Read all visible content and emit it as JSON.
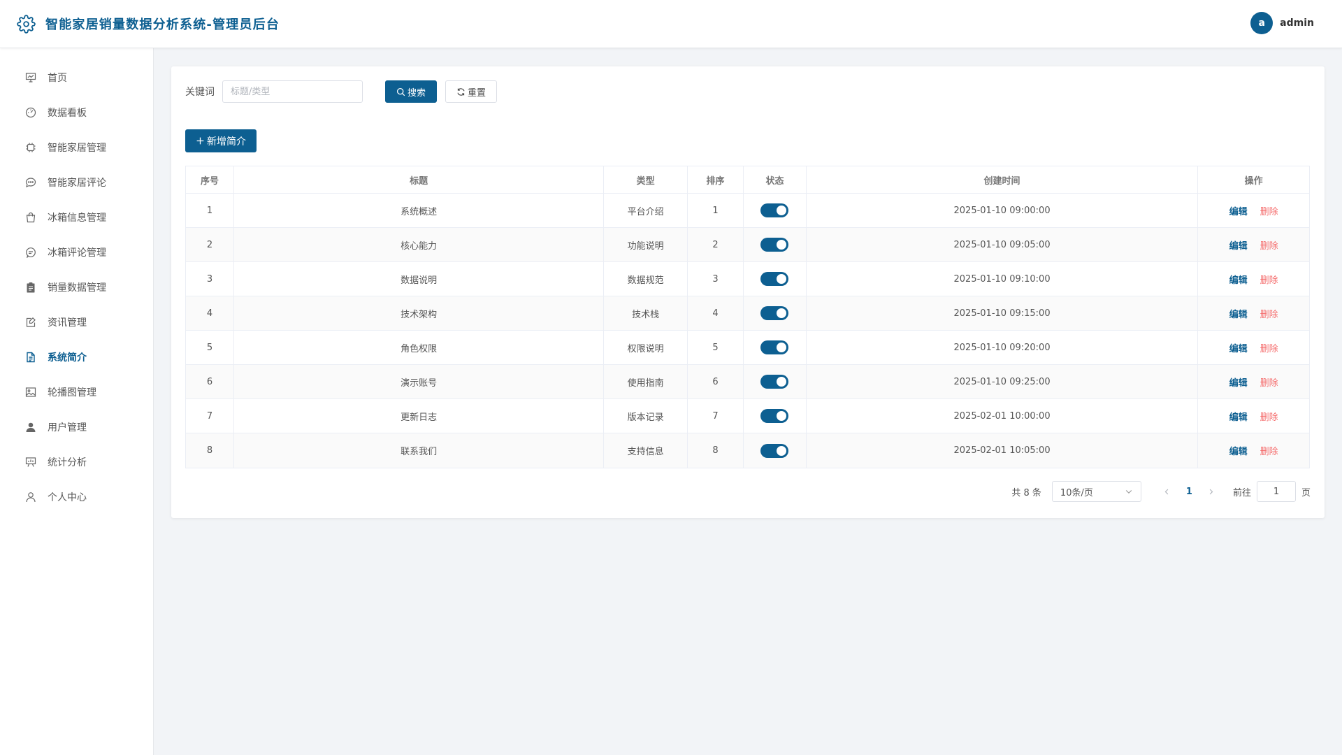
{
  "header": {
    "title": "智能家居销量数据分析系统-管理员后台",
    "avatar_letter": "a",
    "username": "admin"
  },
  "sidebar": {
    "items": [
      {
        "label": "首页",
        "icon": "presentation-icon"
      },
      {
        "label": "数据看板",
        "icon": "dashboard-gauge-icon"
      },
      {
        "label": "智能家居管理",
        "icon": "cpu-chip-icon"
      },
      {
        "label": "智能家居评论",
        "icon": "chat-bubble-icon"
      },
      {
        "label": "冰箱信息管理",
        "icon": "shopping-bag-icon"
      },
      {
        "label": "冰箱评论管理",
        "icon": "chat-dots-icon"
      },
      {
        "label": "销量数据管理",
        "icon": "clipboard-icon"
      },
      {
        "label": "资讯管理",
        "icon": "edit-note-icon"
      },
      {
        "label": "系统简介",
        "icon": "document-icon"
      },
      {
        "label": "轮播图管理",
        "icon": "picture-icon"
      },
      {
        "label": "用户管理",
        "icon": "user-filled-icon"
      },
      {
        "label": "统计分析",
        "icon": "chart-board-icon"
      },
      {
        "label": "个人中心",
        "icon": "user-outline-icon"
      }
    ],
    "active_index": 8
  },
  "search": {
    "label": "关键词",
    "placeholder": "标题/类型",
    "value": "",
    "search_button": "搜索",
    "reset_button": "重置"
  },
  "add_button": "新增简介",
  "table": {
    "headers": [
      "序号",
      "标题",
      "类型",
      "排序",
      "状态",
      "创建时间",
      "操作"
    ],
    "rows": [
      {
        "index": "1",
        "title": "系统概述",
        "type": "平台介绍",
        "sort": "1",
        "enabled": true,
        "created": "2025-01-10 09:00:00"
      },
      {
        "index": "2",
        "title": "核心能力",
        "type": "功能说明",
        "sort": "2",
        "enabled": true,
        "created": "2025-01-10 09:05:00"
      },
      {
        "index": "3",
        "title": "数据说明",
        "type": "数据规范",
        "sort": "3",
        "enabled": true,
        "created": "2025-01-10 09:10:00"
      },
      {
        "index": "4",
        "title": "技术架构",
        "type": "技术栈",
        "sort": "4",
        "enabled": true,
        "created": "2025-01-10 09:15:00"
      },
      {
        "index": "5",
        "title": "角色权限",
        "type": "权限说明",
        "sort": "5",
        "enabled": true,
        "created": "2025-01-10 09:20:00"
      },
      {
        "index": "6",
        "title": "演示账号",
        "type": "使用指南",
        "sort": "6",
        "enabled": true,
        "created": "2025-01-10 09:25:00"
      },
      {
        "index": "7",
        "title": "更新日志",
        "type": "版本记录",
        "sort": "7",
        "enabled": true,
        "created": "2025-02-01 10:00:00"
      },
      {
        "index": "8",
        "title": "联系我们",
        "type": "支持信息",
        "sort": "8",
        "enabled": true,
        "created": "2025-02-01 10:05:00"
      }
    ],
    "edit_label": "编辑",
    "delete_label": "删除"
  },
  "pagination": {
    "total_text": "共 8 条",
    "page_size": "10条/页",
    "current_page": "1",
    "goto_label": "前往",
    "goto_value": "1",
    "page_suffix": "页"
  },
  "colors": {
    "primary": "#0d5f91",
    "danger": "#f56c6c",
    "background": "#f2f4f7"
  }
}
